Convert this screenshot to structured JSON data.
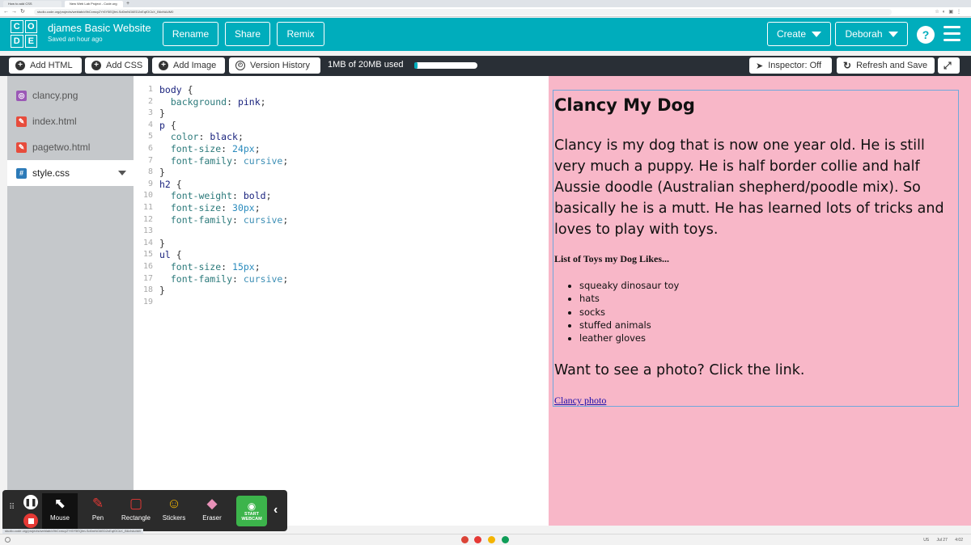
{
  "browser": {
    "tabs": [
      {
        "label": "How to add CSS",
        "active": false
      },
      {
        "label": "New Web Lab Project - Code.org",
        "active": true
      }
    ],
    "url": "studio.code.org/projects/weblab/c9bCxmcy2Yr5Y5EQfeLSd0mNG6ED2xEqfOCkX_B6vNA4M0"
  },
  "header": {
    "logo_letters": [
      "C",
      "O",
      "D",
      "E"
    ],
    "project_title": "djames Basic Website",
    "saved_status": "Saved an hour ago",
    "rename_label": "Rename",
    "share_label": "Share",
    "remix_label": "Remix",
    "create_label": "Create",
    "user_label": "Deborah",
    "help_label": "?"
  },
  "toolbar": {
    "add_html_label": "Add HTML",
    "add_css_label": "Add CSS",
    "add_image_label": "Add Image",
    "version_history_label": "Version History",
    "usage_text": "1MB of 20MB used",
    "usage_fraction": 0.05,
    "inspector_label": "Inspector: Off",
    "refresh_label": "Refresh and Save"
  },
  "files": [
    {
      "name": "clancy.png",
      "icon": "image-file-icon",
      "color": "#9b59b6",
      "active": false
    },
    {
      "name": "index.html",
      "icon": "html-file-icon",
      "color": "#e74c3c",
      "active": false
    },
    {
      "name": "pagetwo.html",
      "icon": "html-file-icon",
      "color": "#e74c3c",
      "active": false
    },
    {
      "name": "style.css",
      "icon": "css-file-icon",
      "color": "#2c7ab8",
      "active": true
    }
  ],
  "code_lines": [
    [
      [
        "sel",
        "body "
      ],
      [
        "pun",
        "{"
      ]
    ],
    [
      [
        "prop",
        "  background"
      ],
      [
        "pun",
        ": "
      ],
      [
        "val",
        "pink"
      ],
      [
        "pun",
        ";"
      ]
    ],
    [
      [
        "pun",
        "}"
      ]
    ],
    [
      [
        "sel",
        "p "
      ],
      [
        "pun",
        "{"
      ]
    ],
    [
      [
        "prop",
        "  color"
      ],
      [
        "pun",
        ": "
      ],
      [
        "val",
        "black"
      ],
      [
        "pun",
        ";"
      ]
    ],
    [
      [
        "prop",
        "  font-size"
      ],
      [
        "pun",
        ": "
      ],
      [
        "num",
        "24px"
      ],
      [
        "pun",
        ";"
      ]
    ],
    [
      [
        "prop",
        "  font-family"
      ],
      [
        "pun",
        ": "
      ],
      [
        "kw",
        "cursive"
      ],
      [
        "pun",
        ";"
      ]
    ],
    [
      [
        "pun",
        "}"
      ]
    ],
    [
      [
        "sel",
        "h2 "
      ],
      [
        "pun",
        "{"
      ]
    ],
    [
      [
        "prop",
        "  font-weight"
      ],
      [
        "pun",
        ": "
      ],
      [
        "val",
        "bold"
      ],
      [
        "pun",
        ";"
      ]
    ],
    [
      [
        "prop",
        "  font-size"
      ],
      [
        "pun",
        ": "
      ],
      [
        "num",
        "30px"
      ],
      [
        "pun",
        ";"
      ]
    ],
    [
      [
        "prop",
        "  font-family"
      ],
      [
        "pun",
        ": "
      ],
      [
        "kw",
        "cursive"
      ],
      [
        "pun",
        ";"
      ]
    ],
    [],
    [
      [
        "pun",
        "}"
      ]
    ],
    [
      [
        "sel",
        "ul "
      ],
      [
        "pun",
        "{"
      ]
    ],
    [
      [
        "prop",
        "  font-size"
      ],
      [
        "pun",
        ": "
      ],
      [
        "num",
        "15px"
      ],
      [
        "pun",
        ";"
      ]
    ],
    [
      [
        "prop",
        "  font-family"
      ],
      [
        "pun",
        ": "
      ],
      [
        "kw",
        "cursive"
      ],
      [
        "pun",
        ";"
      ]
    ],
    [
      [
        "pun",
        "}"
      ]
    ],
    []
  ],
  "preview": {
    "heading": "Clancy My Dog",
    "paragraph1": "Clancy is my dog that is now one year old. He is still very much a puppy. He is half border collie and half Aussie doodle (Australian shepherd/poodle mix). So basically he is a mutt. He has learned lots of tricks and loves to play with toys.",
    "list_heading": "List of Toys my Dog Likes...",
    "toys": [
      "squeaky dinosaur toy",
      "hats",
      "socks",
      "stuffed animals",
      "leather gloves"
    ],
    "paragraph2": "Want to see a photo? Click the link.",
    "link_text": "Clancy photo"
  },
  "recorder": {
    "tools": [
      {
        "label": "Mouse",
        "icon": "cursor-icon",
        "selected": true
      },
      {
        "label": "Pen",
        "icon": "pen-icon",
        "selected": false
      },
      {
        "label": "Rectangle",
        "icon": "rectangle-icon",
        "selected": false
      },
      {
        "label": "Stickers",
        "icon": "sticker-icon",
        "selected": false
      },
      {
        "label": "Eraser",
        "icon": "eraser-icon",
        "selected": false
      }
    ],
    "webcam_label": "START WEBCAM"
  },
  "taskbar": {
    "locale": "US",
    "date": "Jul 27",
    "time": "4:02"
  }
}
